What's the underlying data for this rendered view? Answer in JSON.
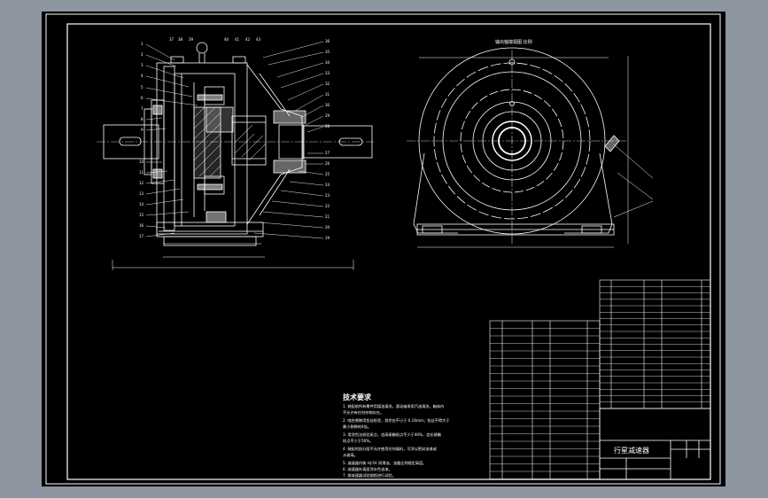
{
  "colors": {
    "background": "#8d95a1",
    "canvas": "#000000",
    "line": "#ffffff",
    "centerline": "#c8c8c8"
  },
  "drawing": {
    "title": "行星减速器",
    "side_view_caption": "输出轴端视图 比例",
    "notes": {
      "title": "技术要求",
      "lines": [
        "1. 装配前所有零件用煤油清洗，滚动轴承用汽油清洗，箱体内",
        "   不允许有任何杂物存在。",
        "2. 啮合侧隙用铅丝检验，其余应不小于 0.16mm；铅丝不得大于",
        "   最小侧隙的4倍。",
        "3. 用涂色法检验斑点，齿高接触斑点不少于40%，齿长接触",
        "   斑点不少于50%。",
        "4. 装配时剖分面不允许使用任何填料，可涂以密封油漆或",
        "   水玻璃。",
        "5. 减速器内装 HJ-50 润滑油，油量达到规定高度。",
        "6. 减速器外表面涂灰色油漆。",
        "7. 按减速器试验规程进行试验。"
      ]
    }
  }
}
